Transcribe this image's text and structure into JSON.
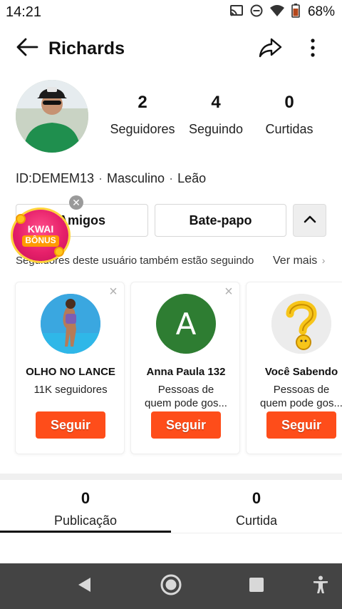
{
  "status_bar": {
    "time": "14:21",
    "battery_pct": "68%",
    "icons": [
      "cast-icon",
      "do-not-disturb-icon",
      "wifi-icon",
      "battery-icon"
    ]
  },
  "header": {
    "title": "Richards",
    "back_icon": "arrow-left-icon",
    "share_icon": "share-icon",
    "more_icon": "more-vertical-icon"
  },
  "profile": {
    "stats": [
      {
        "value": "2",
        "label": "Seguidores"
      },
      {
        "value": "4",
        "label": "Seguindo"
      },
      {
        "value": "0",
        "label": "Curtidas"
      }
    ],
    "id": "ID:DEMEM13",
    "gender": "Masculino",
    "sign": "Leão"
  },
  "actions": {
    "friends_label": "Amigos",
    "chat_label": "Bate-papo",
    "expand_icon": "chevron-up-icon"
  },
  "bonus_badge": {
    "line1": "KWAI",
    "line2": "BÔNUS"
  },
  "suggestions": {
    "title": "Seguidores deste usuário também estão seguindo",
    "see_more": "Ver mais",
    "cards": [
      {
        "name": "OLHO NO LANCE",
        "sub1": "11K seguidores",
        "sub2": "",
        "button": "Seguir"
      },
      {
        "name": "Anna Paula 132",
        "letter": "A",
        "sub1": "Pessoas de",
        "sub2": "quem pode gos...",
        "button": "Seguir"
      },
      {
        "name": "Você Sabendo",
        "sub1": "Pessoas de",
        "sub2": "quem pode gos...",
        "button": "Seguir"
      }
    ]
  },
  "tabs": [
    {
      "value": "0",
      "label": "Publicação",
      "active": true
    },
    {
      "value": "0",
      "label": "Curtida",
      "active": false
    }
  ],
  "colors": {
    "accent": "#fe4d1a",
    "bonus": "#e6206a",
    "nav_bar": "#444444"
  }
}
